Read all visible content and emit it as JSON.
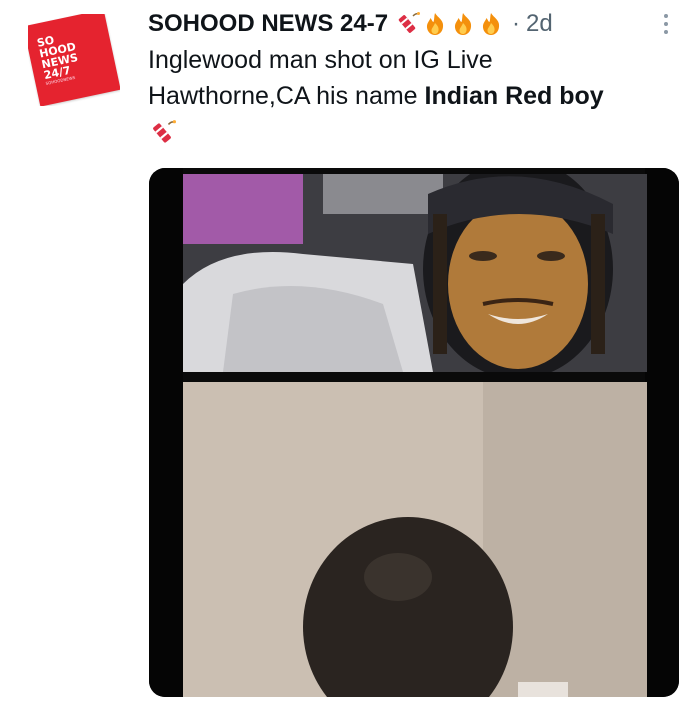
{
  "account": {
    "display_name": "SOHOOD NEWS 24-7",
    "avatar_text": [
      "SO",
      "HOOD",
      "NEWS",
      "24/7"
    ],
    "avatar_subtext": "SOHOODNEWS",
    "name_emojis": [
      "firecracker-emoji",
      "fire-emoji",
      "fire-emoji",
      "fire-emoji"
    ],
    "separator": "·",
    "timestamp": "2d"
  },
  "tweet": {
    "line1": "Inglewood man shot on IG Live",
    "line2_plain": "Hawthorne,CA his name ",
    "line2_bold": "Indian Red boy",
    "trailing_emoji": "firecracker-emoji"
  },
  "media": {
    "type": "video-still",
    "description_panes": [
      "top-pane",
      "bottom-pane"
    ]
  },
  "colors": {
    "text_primary": "#0f1419",
    "text_secondary": "#536471",
    "avatar_red": "#e5232f",
    "media_border": "#0a0a0a"
  }
}
